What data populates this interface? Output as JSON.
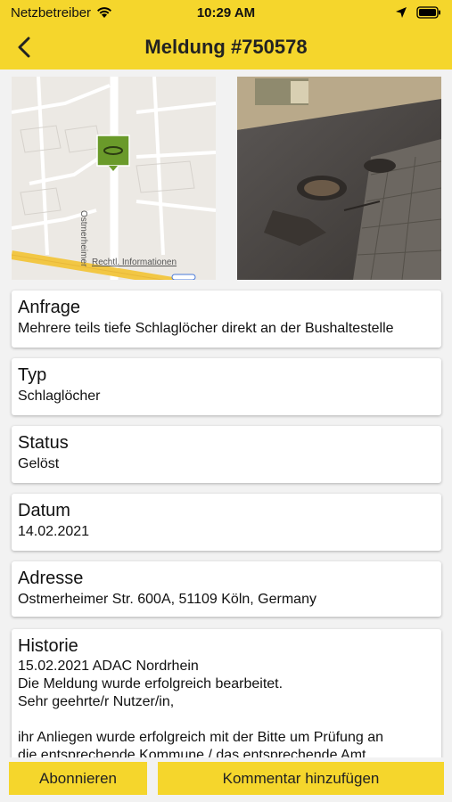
{
  "status_bar": {
    "carrier": "Netzbetreiber",
    "time": "10:29 AM"
  },
  "nav": {
    "title": "Meldung #750578",
    "back_icon": "chevron-left-icon"
  },
  "map": {
    "street_label": "Ostmerheimer",
    "legal_link": "Rechtl. Informationen"
  },
  "details": {
    "anfrage": {
      "label": "Anfrage",
      "value": "Mehrere teils tiefe Schlaglöcher direkt an der Bushaltestelle"
    },
    "typ": {
      "label": "Typ",
      "value": "Schlaglöcher"
    },
    "status": {
      "label": "Status",
      "value": "Gelöst"
    },
    "datum": {
      "label": "Datum",
      "value": "14.02.2021"
    },
    "adresse": {
      "label": "Adresse",
      "value": "Ostmerheimer Str. 600A, 51109 Köln, Germany"
    },
    "historie": {
      "label": "Historie",
      "text": "15.02.2021 ADAC Nordrhein\nDie Meldung wurde erfolgreich bearbeitet.\nSehr geehrte/r Nutzer/in,\n\nihr Anliegen wurde erfolgreich mit der Bitte um Prüfung an\ndie entsprechende Kommune / das entsprechende Amt"
    }
  },
  "actions": {
    "subscribe": "Abonnieren",
    "comment": "Kommentar hinzufügen"
  },
  "colors": {
    "accent": "#f5d62c",
    "marker": "#6a9a2a"
  }
}
